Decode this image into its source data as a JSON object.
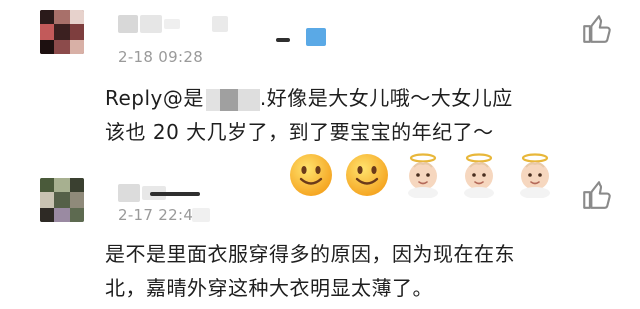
{
  "comments": [
    {
      "avatar_icon": "blurred-avatar",
      "timestamp": "2-18 09:28",
      "reply_prefix": "Reply@是",
      "reply_suffix": ".好像是大女儿哦～大女儿应",
      "line2": "该也 20 大几岁了，到了要宝宝的年纪了～",
      "emojis": [
        "smiling-face",
        "smiling-face",
        "baby-angel",
        "baby-angel",
        "baby-angel"
      ],
      "like_icon": "thumbs-up-icon"
    },
    {
      "avatar_icon": "blurred-avatar",
      "timestamp": "2-17 22:4",
      "line1": "是不是里面衣服穿得多的原因，因为现在在东",
      "line2": "北，嘉晴外穿这种大衣明显太薄了。",
      "like_icon": "thumbs-up-icon"
    }
  ],
  "colors": {
    "text": "#1e1e1e",
    "meta": "#9a9a9a",
    "accent_blur": "#5aa9e6"
  }
}
